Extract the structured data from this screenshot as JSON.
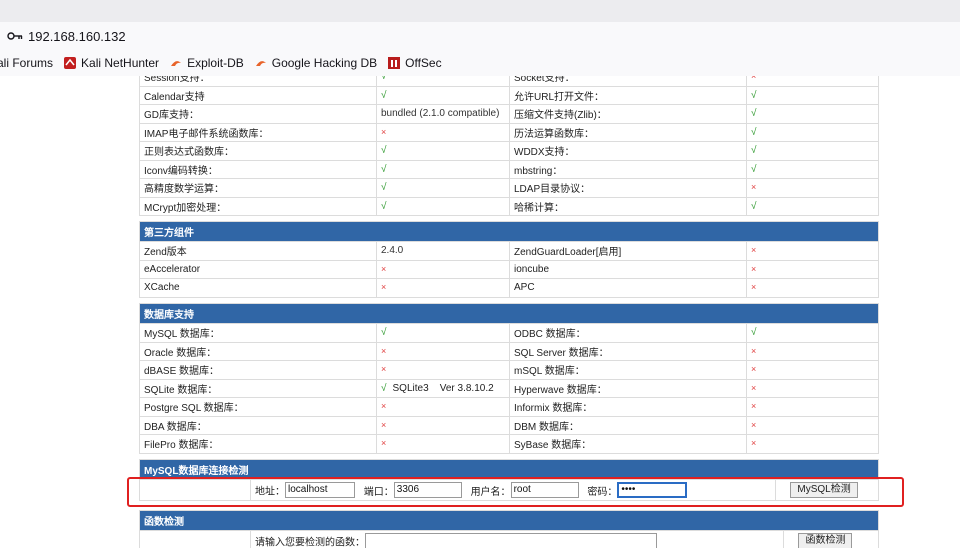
{
  "browser": {
    "url": "192.168.160.132",
    "bookmarks": [
      {
        "label": "ali Forums"
      },
      {
        "label": "Kali NetHunter"
      },
      {
        "label": "Exploit-DB"
      },
      {
        "label": "Google Hacking DB"
      },
      {
        "label": "OffSec"
      }
    ]
  },
  "colors": {
    "section_header": "#3066a6",
    "ok": "#2f9a2f",
    "no": "#e04040",
    "highlight": "#e02020"
  },
  "symbols": {
    "ok": "√",
    "no": "×"
  },
  "basic": {
    "rows": [
      {
        "a": "Session支持：",
        "av": "√",
        "b": "Socket支持：",
        "bv": "×"
      },
      {
        "a": "Calendar支持",
        "av": "√",
        "b": "允许URL打开文件：",
        "bv": "√"
      },
      {
        "a": "GD库支持：",
        "av": "bundled (2.1.0 compatible)",
        "b": "压缩文件支持(Zlib)：",
        "bv": "√"
      },
      {
        "a": "IMAP电子邮件系统函数库：",
        "av": "×",
        "b": "历法运算函数库：",
        "bv": "√"
      },
      {
        "a": "正则表达式函数库：",
        "av": "√",
        "b": "WDDX支持：",
        "bv": "√"
      },
      {
        "a": "Iconv编码转换：",
        "av": "√",
        "b": "mbstring：",
        "bv": "√"
      },
      {
        "a": "高精度数学运算：",
        "av": "√",
        "b": "LDAP目录协议：",
        "bv": "×"
      },
      {
        "a": "MCrypt加密处理：",
        "av": "√",
        "b": "哈稀计算：",
        "bv": "√"
      }
    ]
  },
  "third_party": {
    "title": "第三方组件",
    "rows": [
      {
        "a": "Zend版本",
        "av": "2.4.0",
        "b": "ZendGuardLoader[启用]",
        "bv": "×"
      },
      {
        "a": "eAccelerator",
        "av": "×",
        "b": "ioncube",
        "bv": "×"
      },
      {
        "a": "XCache",
        "av": "×",
        "b": "APC",
        "bv": "×"
      }
    ]
  },
  "database": {
    "title": "数据库支持",
    "rows": [
      {
        "a": "MySQL 数据库：",
        "av": "√",
        "b": "ODBC 数据库：",
        "bv": "√"
      },
      {
        "a": "Oracle 数据库：",
        "av": "×",
        "b": "SQL Server 数据库：",
        "bv": "×"
      },
      {
        "a": "dBASE 数据库：",
        "av": "×",
        "b": "mSQL 数据库：",
        "bv": "×"
      },
      {
        "a": "SQLite 数据库：",
        "av": "√",
        "av_extra": "SQLite3    Ver 3.8.10.2",
        "b": "Hyperwave 数据库：",
        "bv": "×"
      },
      {
        "a": "Postgre SQL 数据库：",
        "av": "×",
        "b": "Informix 数据库：",
        "bv": "×"
      },
      {
        "a": "DBA 数据库：",
        "av": "×",
        "b": "DBM 数据库：",
        "bv": "×"
      },
      {
        "a": "FilePro 数据库：",
        "av": "×",
        "b": "SyBase 数据库：",
        "bv": "×"
      }
    ]
  },
  "mysql_check": {
    "title": "MySQL数据库连接检测",
    "host_label": "地址：",
    "host_value": "localhost",
    "port_label": "端口：",
    "port_value": "3306",
    "user_label": "用户名：",
    "user_value": "root",
    "pass_label": "密码：",
    "pass_value": "••••",
    "button": "MySQL检测"
  },
  "func_check": {
    "title": "函数检测",
    "label": "请输入您要检测的函数：",
    "value": "",
    "button": "函数检测"
  }
}
